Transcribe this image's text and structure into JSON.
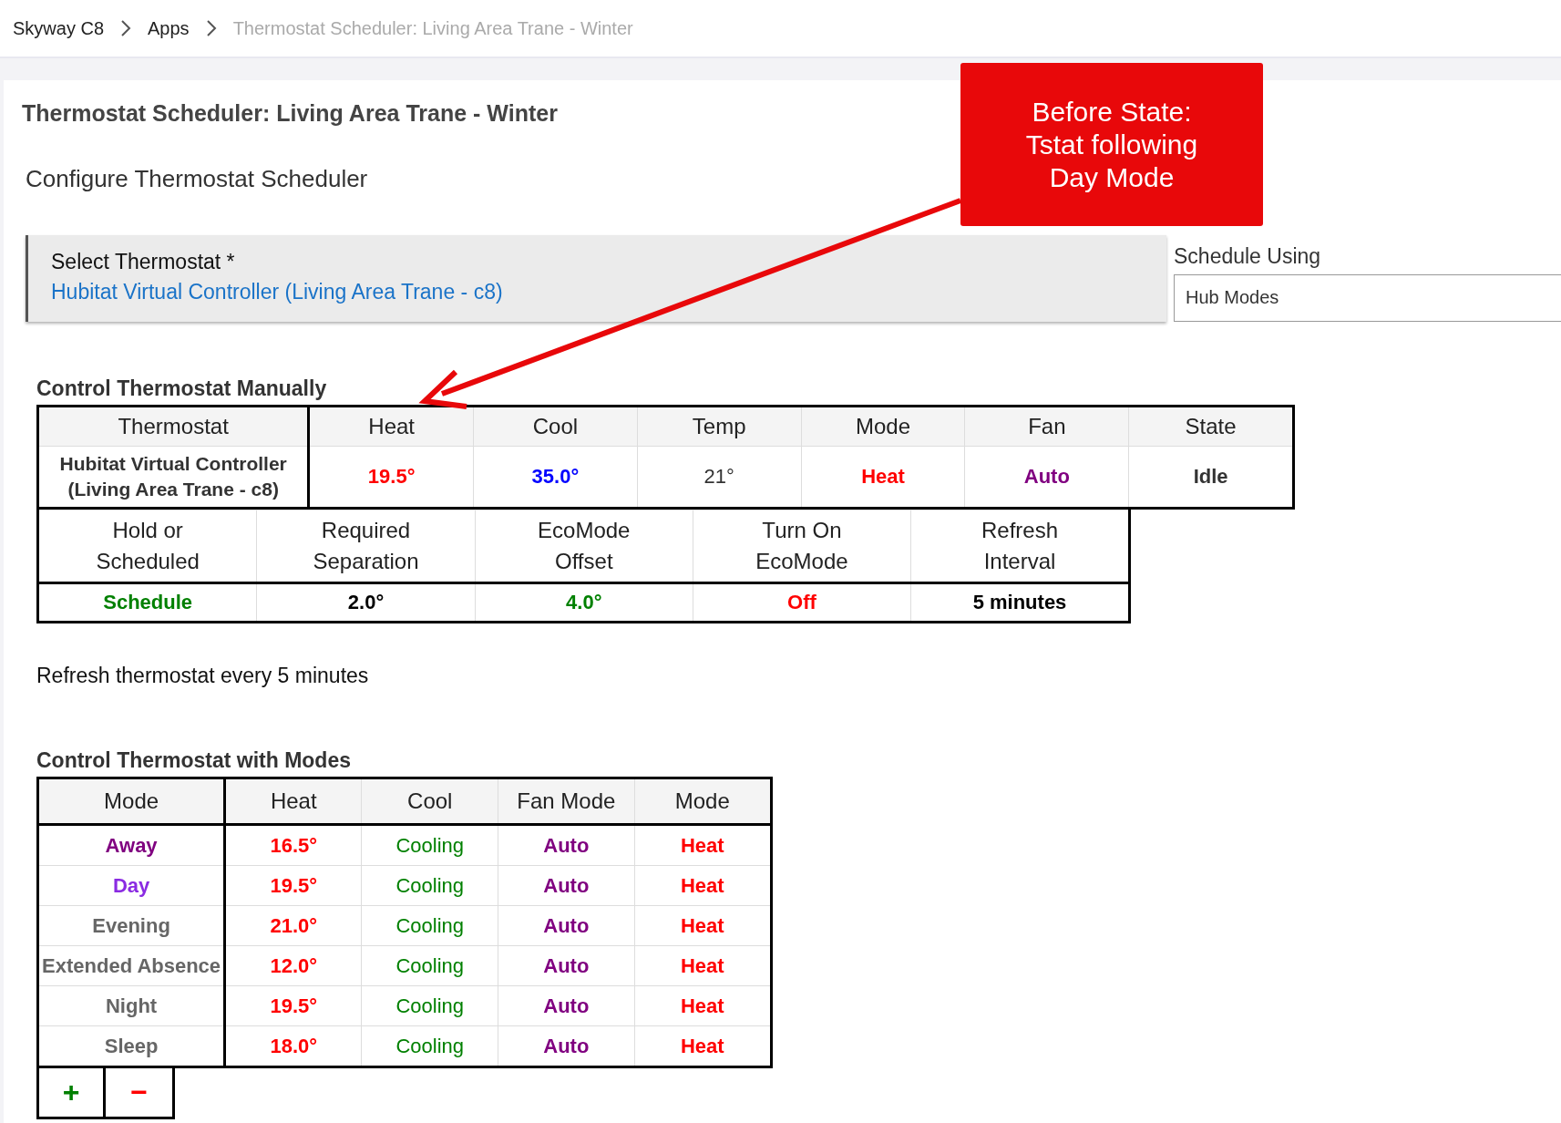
{
  "breadcrumb": [
    {
      "text": "Skyway C8",
      "current": false
    },
    {
      "text": "Apps",
      "current": false
    },
    {
      "text": "Thermostat Scheduler: Living Area Trane - Winter",
      "current": true
    }
  ],
  "page_title": "Thermostat Scheduler: Living Area Trane - Winter",
  "section_title": "Configure Thermostat Scheduler",
  "select_thermostat": {
    "label": "Select Thermostat *",
    "value": "Hubitat Virtual Controller (Living Area Trane - c8)"
  },
  "schedule_using": {
    "label": "Schedule Using",
    "value": "Hub Modes"
  },
  "annotation": {
    "text": "Before State: Tstat following Day Mode"
  },
  "manual": {
    "title": "Control Thermostat Manually",
    "columns": [
      "Thermostat",
      "Heat",
      "Cool",
      "Temp",
      "Mode",
      "Fan",
      "State"
    ],
    "row": [
      {
        "text": "Hubitat Virtual Controller (Living Area Trane - c8)",
        "color": "#333333",
        "bold": true
      },
      {
        "text": "19.5°",
        "color": "#ff0000",
        "bold": true
      },
      {
        "text": "35.0°",
        "color": "#0000ff",
        "bold": true
      },
      {
        "text": "21°",
        "color": "#333333",
        "bold": false
      },
      {
        "text": "Heat",
        "color": "#ff0000",
        "bold": true
      },
      {
        "text": "Auto",
        "color": "#800080",
        "bold": true
      },
      {
        "text": "Idle",
        "color": "#333333",
        "bold": true
      }
    ]
  },
  "settings": {
    "columns": [
      "Hold or Scheduled",
      "Required Separation",
      "EcoMode Offset",
      "Turn On EcoMode",
      "Refresh Interval"
    ],
    "row": [
      {
        "text": "Schedule",
        "color": "#008000",
        "bold": true
      },
      {
        "text": "2.0°",
        "color": "#000000",
        "bold": true
      },
      {
        "text": "4.0°",
        "color": "#008000",
        "bold": true
      },
      {
        "text": "Off",
        "color": "#ff0000",
        "bold": true
      },
      {
        "text": "5 minutes",
        "color": "#000000",
        "bold": true
      }
    ]
  },
  "refresh_note": "Refresh thermostat every 5 minutes",
  "modes": {
    "title": "Control Thermostat with Modes",
    "columns": [
      "Mode",
      "Heat",
      "Cool",
      "Fan Mode",
      "Mode"
    ],
    "rows": [
      [
        {
          "text": "Away",
          "color": "#800080",
          "bold": true
        },
        {
          "text": "16.5°",
          "color": "#ff0000",
          "bold": true
        },
        {
          "text": "Cooling",
          "color": "#008000",
          "bold": false
        },
        {
          "text": "Auto",
          "color": "#800080",
          "bold": true
        },
        {
          "text": "Heat",
          "color": "#ff0000",
          "bold": true
        }
      ],
      [
        {
          "text": "Day",
          "color": "#8a2be2",
          "bold": true
        },
        {
          "text": "19.5°",
          "color": "#ff0000",
          "bold": true
        },
        {
          "text": "Cooling",
          "color": "#008000",
          "bold": false
        },
        {
          "text": "Auto",
          "color": "#800080",
          "bold": true
        },
        {
          "text": "Heat",
          "color": "#ff0000",
          "bold": true
        }
      ],
      [
        {
          "text": "Evening",
          "color": "#666666",
          "bold": true
        },
        {
          "text": "21.0°",
          "color": "#ff0000",
          "bold": true
        },
        {
          "text": "Cooling",
          "color": "#008000",
          "bold": false
        },
        {
          "text": "Auto",
          "color": "#800080",
          "bold": true
        },
        {
          "text": "Heat",
          "color": "#ff0000",
          "bold": true
        }
      ],
      [
        {
          "text": "Extended Absence",
          "color": "#666666",
          "bold": true
        },
        {
          "text": "12.0°",
          "color": "#ff0000",
          "bold": true
        },
        {
          "text": "Cooling",
          "color": "#008000",
          "bold": false
        },
        {
          "text": "Auto",
          "color": "#800080",
          "bold": true
        },
        {
          "text": "Heat",
          "color": "#ff0000",
          "bold": true
        }
      ],
      [
        {
          "text": "Night",
          "color": "#666666",
          "bold": true
        },
        {
          "text": "19.5°",
          "color": "#ff0000",
          "bold": true
        },
        {
          "text": "Cooling",
          "color": "#008000",
          "bold": false
        },
        {
          "text": "Auto",
          "color": "#800080",
          "bold": true
        },
        {
          "text": "Heat",
          "color": "#ff0000",
          "bold": true
        }
      ],
      [
        {
          "text": "Sleep",
          "color": "#666666",
          "bold": true
        },
        {
          "text": "18.0°",
          "color": "#ff0000",
          "bold": true
        },
        {
          "text": "Cooling",
          "color": "#008000",
          "bold": false
        },
        {
          "text": "Auto",
          "color": "#800080",
          "bold": true
        },
        {
          "text": "Heat",
          "color": "#ff0000",
          "bold": true
        }
      ]
    ],
    "buttons": [
      {
        "text": "+",
        "color": "#008000"
      },
      {
        "text": "−",
        "color": "#ff0000"
      }
    ]
  }
}
